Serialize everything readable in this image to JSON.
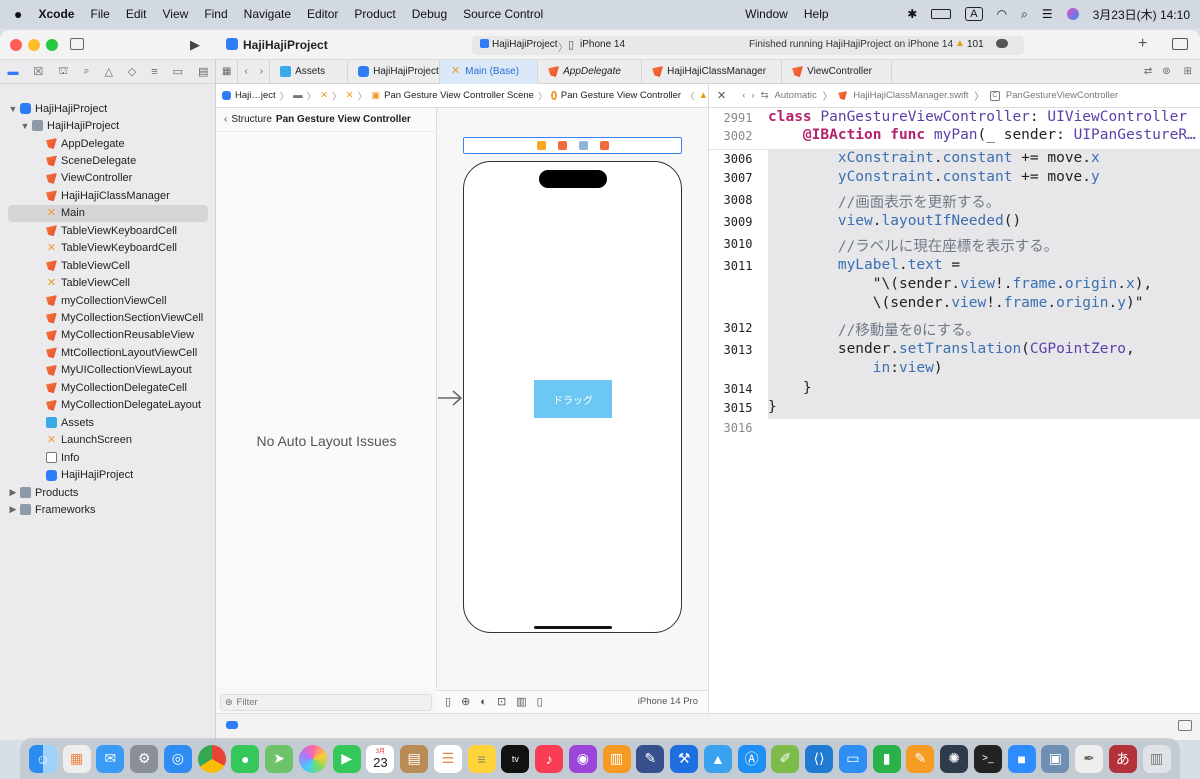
{
  "menubar": {
    "app": "Xcode",
    "items": [
      "File",
      "Edit",
      "View",
      "Find",
      "Navigate",
      "Editor",
      "Product",
      "Debug",
      "Source Control",
      "Window",
      "Help"
    ],
    "input_mode": "A",
    "datetime": "3月23日(木)  14:10"
  },
  "toolbar": {
    "project": "HajiHajiProject",
    "scheme": "HajiHajiProject",
    "device": "iPhone 14",
    "status": "Finished running HajiHajiProject on iPhone 14",
    "warnings": "101"
  },
  "tabs": [
    {
      "label": "Assets"
    },
    {
      "label": "HajiHajiProject"
    },
    {
      "label": "Main (Base)"
    },
    {
      "label": "AppDelegate"
    },
    {
      "label": "HajiHajiClassManager"
    },
    {
      "label": "ViewController"
    }
  ],
  "jumpbar_left": {
    "project": "Haji…ject",
    "scene": "Pan Gesture View Controller Scene",
    "controller": "Pan Gesture View Controller"
  },
  "jumpbar_right": {
    "automatic": "Automatic",
    "file": "HajiHajiClassManager.swift",
    "symbol": "PanGestureViewController"
  },
  "navigator": {
    "root": "HajiHajiProject",
    "group": "HajiHajiProject",
    "files": [
      {
        "name": "AppDelegate",
        "kind": "swift"
      },
      {
        "name": "SceneDelegate",
        "kind": "swift"
      },
      {
        "name": "ViewController",
        "kind": "swift"
      },
      {
        "name": "HajiHajiClassManager",
        "kind": "swift"
      },
      {
        "name": "Main",
        "kind": "sb"
      },
      {
        "name": "TableViewKeyboardCell",
        "kind": "swift"
      },
      {
        "name": "TableViewKeyboardCell",
        "kind": "sb"
      },
      {
        "name": "TableViewCell",
        "kind": "swift"
      },
      {
        "name": "TableViewCell",
        "kind": "sb"
      },
      {
        "name": "myCollectionViewCell",
        "kind": "swift"
      },
      {
        "name": "MyCollectionSectionViewCell",
        "kind": "swift"
      },
      {
        "name": "MyCollectionReusableView",
        "kind": "swift"
      },
      {
        "name": "MtCollectionLayoutViewCell",
        "kind": "swift"
      },
      {
        "name": "MyUICollectionViewLayout",
        "kind": "swift"
      },
      {
        "name": "MyCollectionDelegateCell",
        "kind": "swift"
      },
      {
        "name": "MyCollectionDelegateLayout",
        "kind": "swift"
      },
      {
        "name": "Assets",
        "kind": "assets"
      },
      {
        "name": "LaunchScreen",
        "kind": "sb"
      },
      {
        "name": "Info",
        "kind": "info"
      },
      {
        "name": "HajiHajiProject",
        "kind": "app"
      }
    ],
    "groups_bottom": [
      "Products",
      "Frameworks"
    ],
    "filter_placeholder": "Filter"
  },
  "outline": {
    "back_label": "Structure",
    "title": "Pan Gesture View Controller",
    "message": "No Auto Layout Issues",
    "filter_placeholder": "Filter"
  },
  "canvas": {
    "button_label": "ドラッグ",
    "device_label": "iPhone 14 Pro"
  },
  "code": {
    "sticky": [
      {
        "num": "2991",
        "html": "<span class=\"kw\">class</span> <span class=\"ty\">PanGestureViewController</span>: <span class=\"ty\">UIViewController</span>"
      },
      {
        "num": "3002",
        "html": "    <span class=\"kw\">@IBAction func</span> <span class=\"ty\">myPan</span>(_ sender: <span class=\"ty\">UIPanGestureR…</span>"
      }
    ],
    "lines": [
      {
        "num": "3006",
        "html": "        <span class=\"pr\">xConstraint</span>.<span class=\"pr\">constant</span> += move.<span class=\"pr\">x</span>"
      },
      {
        "num": "3007",
        "html": "        <span class=\"pr\">yConstraint</span>.<span class=\"pr\">constant</span> += move.<span class=\"pr\">y</span>"
      },
      {
        "num": "3008",
        "html": "        <span class=\"cm\">//画面表示を更新する。</span>"
      },
      {
        "num": "3009",
        "html": "        <span class=\"pr\">view</span>.<span class=\"pr\">layoutIfNeeded</span>()"
      },
      {
        "num": "3010",
        "html": "        <span class=\"cm\">//ラベルに現在座標を表示する。</span>"
      },
      {
        "num": "3011",
        "html": "        <span class=\"pr\">myLabel</span>.<span class=\"pr\">text</span> ="
      },
      {
        "num": "",
        "html": "            \"\\(sender.<span class=\"pr\">view</span>!.<span class=\"pr\">frame</span>.<span class=\"pr\">origin</span>.<span class=\"pr\">x</span>),"
      },
      {
        "num": "",
        "html": "            \\(sender.<span class=\"pr\">view</span>!.<span class=\"pr\">frame</span>.<span class=\"pr\">origin</span>.<span class=\"pr\">y</span>)\""
      },
      {
        "num": "3012",
        "html": "        <span class=\"cm\">//移動量を0にする。</span>"
      },
      {
        "num": "3013",
        "html": "        sender.<span class=\"pr\">setTranslation</span>(<span class=\"ty\">CGPointZero</span>,"
      },
      {
        "num": "",
        "html": "            <span class=\"pr\">in</span>:<span class=\"pr\">view</span>)"
      },
      {
        "num": "3014",
        "html": "    }"
      },
      {
        "num": "3015",
        "html": "}"
      },
      {
        "num": "3016",
        "html": ""
      }
    ]
  },
  "dock": {
    "calendar_month": "3月",
    "calendar_day": "23"
  }
}
